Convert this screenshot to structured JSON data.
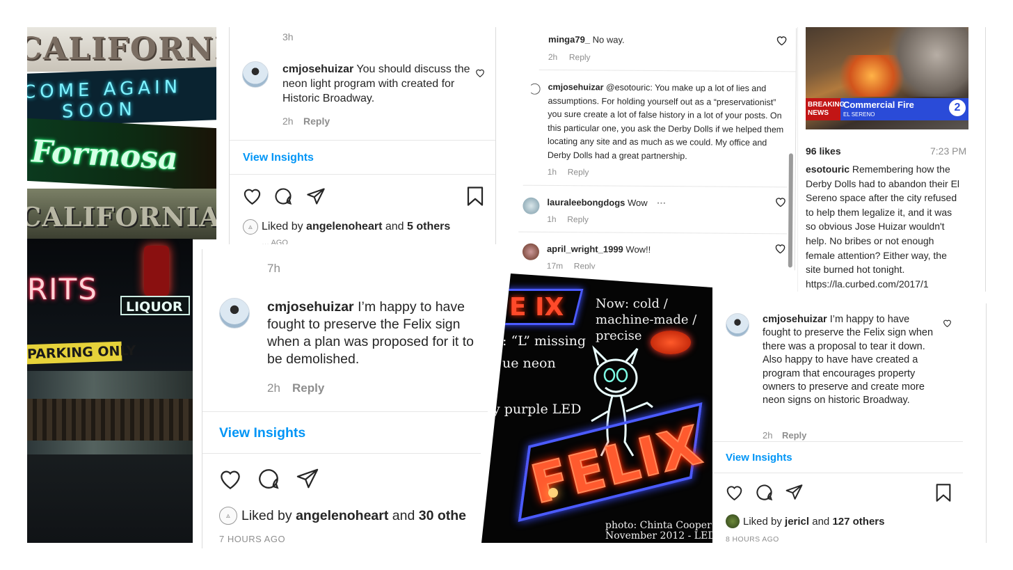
{
  "card1": {
    "time_top": "3h",
    "username": "cmjosehuizar",
    "comment": "You should discuss the neon light program with created for Historic Broadway.",
    "comment_time": "2h",
    "reply": "Reply",
    "insights": "View Insights",
    "liked_prefix": "Liked by",
    "liked_user": "angelenoheart",
    "liked_and": "and",
    "liked_others": "5 others",
    "cut_text": "… AGO"
  },
  "card2": {
    "time_top": "7h",
    "username": "cmjosehuizar",
    "comment": "I’m happy to have fought to preserve the Felix sign when a plan was proposed for it to be demolished.",
    "comment_time": "2h",
    "reply": "Reply",
    "insights": "View Insights",
    "liked_prefix": "Liked by",
    "liked_user": "angelenoheart",
    "liked_and": "and",
    "liked_others": "30 othe",
    "timestamp": "7 HOURS AGO"
  },
  "comments_panel": {
    "c1": {
      "user": "minga79_",
      "text": "No way.",
      "time": "2h",
      "reply": "Reply"
    },
    "c2": {
      "user": "cmjosehuizar",
      "text": "@esotouric: You make up a lot of lies and assumptions. For holding yourself out as a “preservationist” you sure create a lot of false history in a lot of your posts. On this particular one, you ask the Derby Dolls if we helped them locating any site and as much as we could. My office and Derby Dolls had a great partnership.",
      "time": "1h",
      "reply": "Reply"
    },
    "c3": {
      "user": "lauraleebongdogs",
      "text": "Wow",
      "time": "1h",
      "reply": "Reply"
    },
    "c4": {
      "user": "april_wright_1999",
      "text": "Wow!!",
      "time": "17m",
      "reply": "Reply"
    }
  },
  "post_right": {
    "news_banner_left": "BREAKING NEWS",
    "news_banner_title": "Commercial Fire",
    "news_banner_sub": "EL SERENO",
    "news_channel": "2",
    "likes": "96 likes",
    "time": "7:23 PM",
    "user": "esotouric",
    "caption": "Remembering how the Derby Dolls had to abandon their El Sereno space after the city refused to help them legalize it, and it was so obvious Jose Huizar wouldn't help. No bribes or not enough female attention? Either way, the site burned hot tonight.",
    "link": "https://la.curbed.com/2017/1"
  },
  "card3": {
    "username": "cmjosehuizar",
    "comment": "I’m happy to have fought to preserve the Felix sign when there was a proposal to tear it down. Also happy to have have created a program that encourages property owners to preserve and create more neon signs on historic Broadway.",
    "comment_time": "2h",
    "reply": "Reply",
    "insights": "View Insights",
    "liked_prefix": "Liked by",
    "liked_user": "jericl",
    "liked_and": "and",
    "liked_others": "127 others",
    "timestamp": "8 HOURS AGO"
  },
  "felix_photo": {
    "sign": "FELIX",
    "sign_top": "E IX",
    "annot_now": "Now: cold / machine-made / precise",
    "annot_missing": ": “L” missing",
    "annot_neon": "ue neon",
    "annot_led": "y purple LED",
    "credit_line1": "photo: Chinta Cooper",
    "credit_line2": "November 2012 - LED"
  },
  "neon_collage": {
    "sign1": "CALIFORNIAN",
    "sign2_line1": "COME AGAIN",
    "sign2_line2": "SOON",
    "sign3": "Formosa",
    "sign4": "CALIFORNIAN"
  },
  "liquor_photo": {
    "sign_spirits": "RITS",
    "sign_liquor": "LIQUOR",
    "sign_parking": "PARKING ONLY"
  },
  "colors": {
    "link_blue": "#0095f6",
    "meta_gray": "#8e8e8e",
    "neon_red": "#ff3b2f",
    "neon_blue": "#3a4dff"
  }
}
